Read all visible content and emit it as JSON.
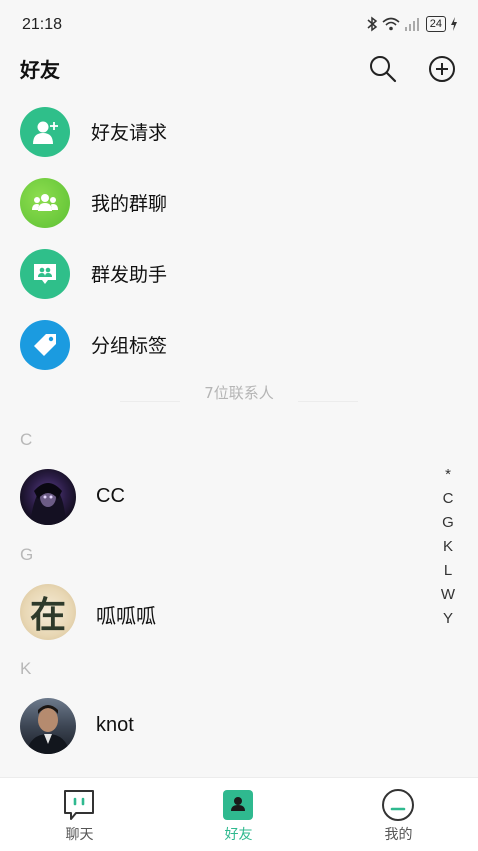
{
  "status_bar": {
    "time": "21:18",
    "battery": "24"
  },
  "header": {
    "title": "好友"
  },
  "menu": [
    {
      "label": "好友请求",
      "icon": "add-friend-icon",
      "color": "#2fbf8a"
    },
    {
      "label": "我的群聊",
      "icon": "group-chat-icon",
      "color": "#6ccf3c"
    },
    {
      "label": "群发助手",
      "icon": "broadcast-icon",
      "color": "#2fbf8a"
    },
    {
      "label": "分组标签",
      "icon": "tag-icon",
      "color": "#1b9be0"
    }
  ],
  "contact_count": "7位联系人",
  "sections": [
    {
      "letter": "C",
      "contacts": [
        {
          "name": "CC",
          "avatar": "dark-anime-avatar"
        }
      ]
    },
    {
      "letter": "G",
      "contacts": [
        {
          "name": "呱呱呱",
          "avatar": "calligraphy-avatar",
          "avatar_char": "在"
        }
      ]
    },
    {
      "letter": "K",
      "contacts": [
        {
          "name": "knot",
          "avatar": "photo-avatar"
        }
      ]
    }
  ],
  "alpha_index": [
    "*",
    "C",
    "G",
    "K",
    "L",
    "W",
    "Y"
  ],
  "tabs": [
    {
      "label": "聊天",
      "icon": "chat-icon",
      "active": false
    },
    {
      "label": "好友",
      "icon": "contacts-icon",
      "active": true
    },
    {
      "label": "我的",
      "icon": "profile-icon",
      "active": false
    }
  ],
  "accent_color": "#2fb98f"
}
